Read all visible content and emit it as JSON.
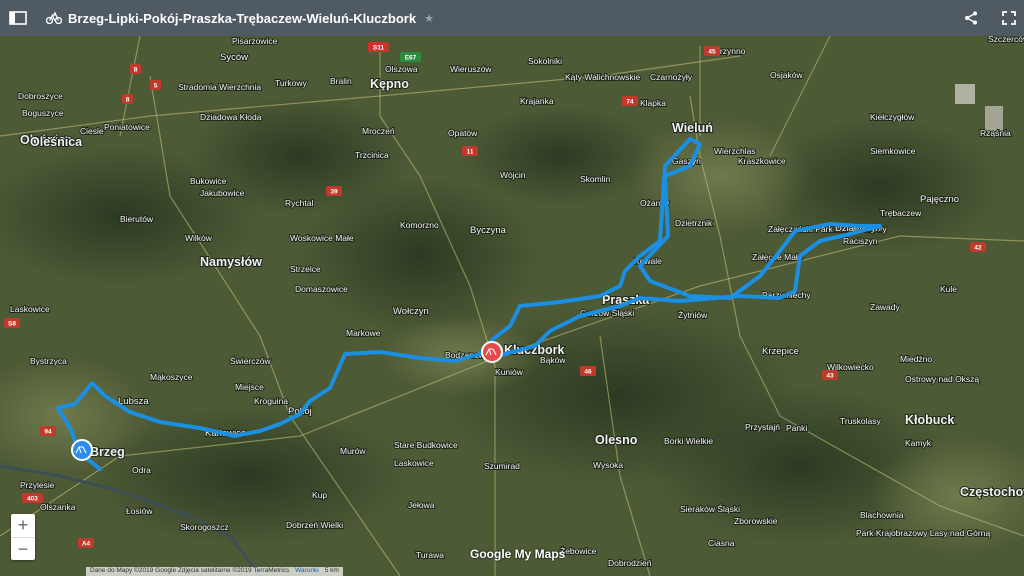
{
  "topbar": {
    "title": "Brzeg-Lipki-Pokój-Praszka-Trębaczew-Wieluń-Kluczbork",
    "sidebar_icon": "sidebar-toggle-icon",
    "activity_icon": "bicycle-icon",
    "star_icon": "star-icon",
    "share_icon": "share-icon",
    "fullscreen_icon": "fullscreen-icon"
  },
  "colors": {
    "route": "#1a8fe3",
    "start_marker": "#2a8ef0",
    "end_marker": "#e6494a",
    "topbar": "#505a63"
  },
  "zoom": {
    "in": "+",
    "out": "−"
  },
  "attribution": {
    "data": "Dane do Mapy ©2019 Google Zdjęcia satelitarne ©2019 TerraMetrics",
    "terms": "Warunki",
    "scale": "5 km"
  },
  "logo": "Google My Maps",
  "places": [
    "Pisarzowice",
    "Syców",
    "Turkowy",
    "Bralin",
    "Olszowa",
    "Wieruszów",
    "Sokolniki",
    "Skrzynno",
    "Osjaków",
    "Szczercóv",
    "Kępno",
    "Kąty Walichnowskie",
    "Czarnożyły",
    "Klapka",
    "Dobroszyce",
    "Stradomia Wierzchnia",
    "Krajanka",
    "Wieluń",
    "Boguszyce",
    "Ciesle",
    "Poniatowice",
    "Dziadowa Kłoda",
    "Mroczeń",
    "Opatów",
    "Kiełczygłów",
    "Rząśnia",
    "Oleśnica",
    "Gaszyn",
    "Wierzchlas",
    "Kraszkowice",
    "Siemkowice",
    "Trzcinica",
    "Wójcin",
    "Skomlin",
    "Bukowice",
    "Jakubowice",
    "Rychtal",
    "Bierutów",
    "Ożarów",
    "Załęczański Park Krajobrazowy",
    "Trębaczew",
    "Pajęczno",
    "Wilków",
    "Woskowice Małe",
    "Komorzno",
    "Byczyna",
    "Dzietrznik",
    "Działoszyn",
    "Raciszyn",
    "Namysłów",
    "Strzelce",
    "Kowale",
    "Załęcze Małe",
    "Praszka",
    "Kule",
    "Domaszowice",
    "Gorzów Śląski",
    "Laskowice",
    "Wołczyn",
    "Żytniów",
    "Parzymiechy",
    "Zawady",
    "Markowe",
    "Kluczbork",
    "Bodzanowice",
    "Krzepice",
    "Bystrzyca",
    "Świerczów",
    "Kuniów",
    "Bąków",
    "Miedźno",
    "Ostrowy nad Okszą",
    "Wilkowiecko",
    "Mąkoszyce",
    "Miejsce",
    "Kroguina",
    "Lubsza",
    "Pokój",
    "Kłobuck",
    "Kamyk",
    "Karłowice",
    "Olesno",
    "Borki Wielkie",
    "Przystajń",
    "Panki",
    "Truskolasy",
    "Brzeg",
    "Stare Budkowice",
    "Laskowice",
    "Szumirad",
    "Wysoka",
    "Murów",
    "Odra",
    "Kup",
    "Przylesie",
    "Jełowa",
    "Sieraków Śląski",
    "Częstochowa",
    "Olszanka",
    "Łosiów",
    "Zborowskie",
    "Blachownia",
    "Skorogoszcz",
    "Dobrzeń Wielki",
    "Turawa",
    "Żebowice",
    "Ciasna",
    "Park Krajobrazowy Lasy nad Górną",
    "Dobrodzień",
    "Oleśnica"
  ],
  "roads": [
    "S11",
    "E67",
    "8",
    "5",
    "39",
    "11",
    "45",
    "42",
    "43",
    "74",
    "94",
    "46",
    "A4",
    "403",
    "8",
    "S8"
  ]
}
